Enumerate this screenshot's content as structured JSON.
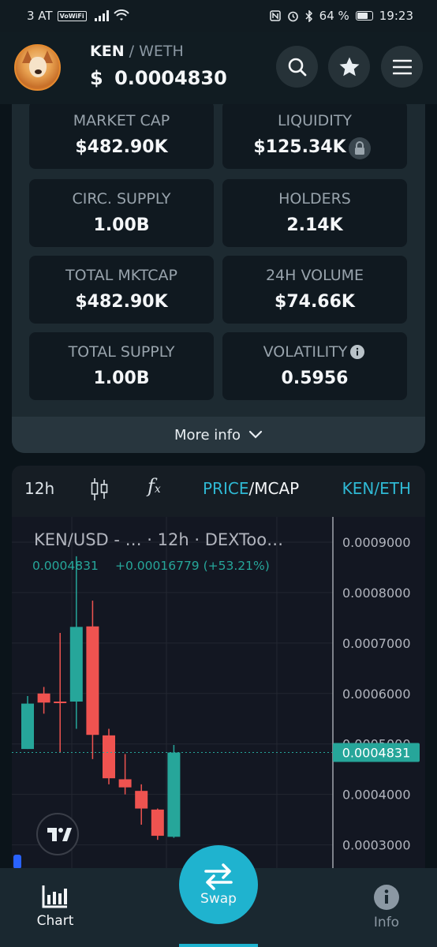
{
  "status": {
    "carrier": "3 AT",
    "vowifi": "VoWiFi",
    "battery": "64 %",
    "time": "19:23"
  },
  "header": {
    "base_symbol": "KEN",
    "separator": "/",
    "quote_symbol": "WETH",
    "price_currency": "$",
    "price": "0.0004830"
  },
  "stats": [
    {
      "label": "MARKET CAP",
      "value": "$482.90K"
    },
    {
      "label": "LIQUIDITY",
      "value": "$125.34K",
      "icon": "lock-icon"
    },
    {
      "label": "CIRC. SUPPLY",
      "value": "1.00B"
    },
    {
      "label": "HOLDERS",
      "value": "2.14K"
    },
    {
      "label": "TOTAL MKTCAP",
      "value": "$482.90K"
    },
    {
      "label": "24H VOLUME",
      "value": "$74.66K"
    },
    {
      "label": "TOTAL SUPPLY",
      "value": "1.00B"
    },
    {
      "label": "VOLATILITY",
      "value": "0.5956",
      "icon": "info-icon"
    }
  ],
  "more_info": "More info",
  "chart_toolbar": {
    "timeframe": "12h",
    "price_label": "PRICE",
    "slash": "/",
    "mcap_label": "MCAP",
    "pair_label": "KEN/ETH"
  },
  "chart_data": {
    "type": "candlestick",
    "title": "KEN/USD - …   · 12h · DEXToo…",
    "last_price_text": "0.0004831",
    "change_text": "+0.00016779 (+53.21%)",
    "price_tag": "0.0004831",
    "y_ticks": [
      "0.0009000",
      "0.0008000",
      "0.0007000",
      "0.0006000",
      "0.0005000",
      "0.0004000",
      "0.0003000"
    ],
    "ylim": [
      0.000254,
      0.00095
    ],
    "last_price": 0.0004831,
    "candles": [
      {
        "o": 0.00049,
        "h": 0.000595,
        "l": 0.00049,
        "c": 0.00058
      },
      {
        "o": 0.0006,
        "h": 0.000613,
        "l": 0.00056,
        "c": 0.000582
      },
      {
        "o": 0.000584,
        "h": 0.00072,
        "l": 0.000484,
        "c": 0.000583
      },
      {
        "o": 0.000584,
        "h": 0.000872,
        "l": 0.00053,
        "c": 0.000732
      },
      {
        "o": 0.000733,
        "h": 0.000784,
        "l": 0.00047,
        "c": 0.000518
      },
      {
        "o": 0.000517,
        "h": 0.00053,
        "l": 0.00042,
        "c": 0.000432
      },
      {
        "o": 0.00043,
        "h": 0.00048,
        "l": 0.0004,
        "c": 0.000414
      },
      {
        "o": 0.000407,
        "h": 0.00042,
        "l": 0.00034,
        "c": 0.000372
      },
      {
        "o": 0.00037,
        "h": 0.000372,
        "l": 0.00031,
        "c": 0.000318
      },
      {
        "o": 0.000316,
        "h": 0.000498,
        "l": 0.000314,
        "c": 0.000483
      }
    ],
    "up_color": "#26a69a",
    "down_color": "#ef5350",
    "grid": true
  },
  "nav": {
    "chart_label": "Chart",
    "swap_label": "Swap",
    "info_label": "Info"
  },
  "colors": {
    "accent": "#1fb3cf",
    "up": "#26a69a",
    "down": "#ef5350"
  }
}
